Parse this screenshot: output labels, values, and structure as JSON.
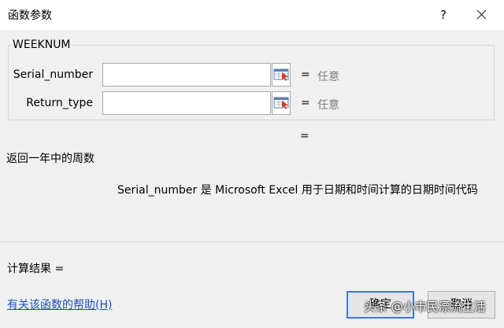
{
  "dialog": {
    "title": "函数参数",
    "help_button": "?"
  },
  "function": {
    "name": "WEEKNUM"
  },
  "arguments": [
    {
      "label": "Serial_number",
      "value": "",
      "equals": "=",
      "result": "任意"
    },
    {
      "label": "Return_type",
      "value": "",
      "equals": "=",
      "result": "任意"
    }
  ],
  "result_equals": "=",
  "description": "返回一年中的周数",
  "param_description": "Serial_number  是 Microsoft Excel 用于日期和时间计算的日期时间代码",
  "calc_result": "计算结果 =",
  "help_link": "有关该函数的帮助(H)",
  "buttons": {
    "ok": "确定",
    "cancel": "取消"
  },
  "watermark": "头条 @小市民漂流生活",
  "icons": {
    "ref": "range-select-icon",
    "close": "close-icon"
  }
}
